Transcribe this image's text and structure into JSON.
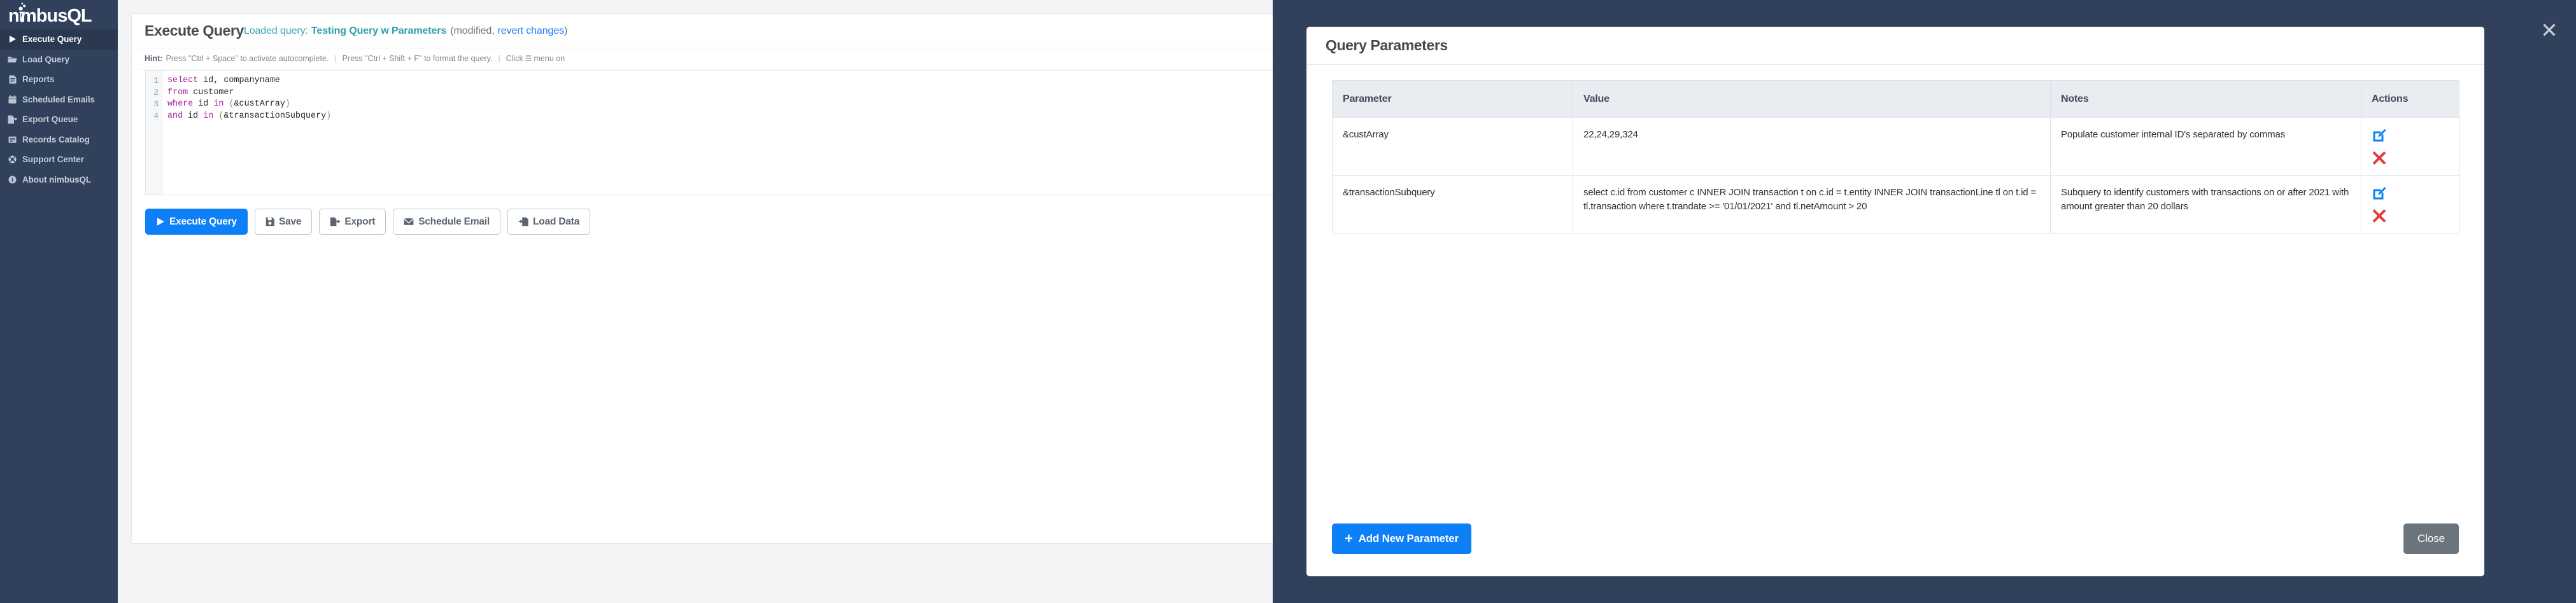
{
  "colors": {
    "sidebar_bg": "#31415c",
    "sidebar_active_bg": "#2a3850",
    "accent_blue": "#0d7ff7",
    "teal": "#2aa0ab",
    "link_blue": "#1a7df0",
    "danger_red": "#e03b3b",
    "close_gray": "#6c757d"
  },
  "sidebar": {
    "brand": "nimbusQL",
    "brand_icon": "flask-icon",
    "items": [
      {
        "label": "Execute Query",
        "icon": "play-icon",
        "active": true
      },
      {
        "label": "Load Query",
        "icon": "folder-open-icon",
        "active": false
      },
      {
        "label": "Reports",
        "icon": "document-icon",
        "active": false
      },
      {
        "label": "Scheduled Emails",
        "icon": "calendar-icon",
        "active": false
      },
      {
        "label": "Export Queue",
        "icon": "file-export-icon",
        "active": false
      },
      {
        "label": "Records Catalog",
        "icon": "database-icon",
        "active": false
      },
      {
        "label": "Support Center",
        "icon": "lifebuoy-icon",
        "active": false
      },
      {
        "label": "About nimbusQL",
        "icon": "info-icon",
        "active": false
      }
    ]
  },
  "main": {
    "page_title": "Execute Query",
    "loaded_prefix": "Loaded query:",
    "loaded_query_name": "Testing Query w Parameters",
    "open_paren": "(",
    "modified_text": "modified,",
    "revert_link": "revert changes",
    "close_paren": ")",
    "hint": {
      "label": "Hint:",
      "part1": "Press \"Ctrl + Space\" to activate autocomplete.",
      "sep": "|",
      "part2": "Press \"Ctrl + Shift + F\" to format the query.",
      "part3_pre": "Click",
      "burger": "☰",
      "part3_post": "menu on"
    },
    "editor": {
      "line_numbers": [
        "1",
        "2",
        "3",
        "4"
      ],
      "lines": [
        {
          "tokens": [
            {
              "t": "select",
              "c": "kw"
            },
            {
              "t": " id, companyname",
              "c": ""
            }
          ]
        },
        {
          "tokens": [
            {
              "t": "from",
              "c": "kw"
            },
            {
              "t": " customer",
              "c": ""
            }
          ]
        },
        {
          "tokens": [
            {
              "t": "where",
              "c": "kw"
            },
            {
              "t": " id ",
              "c": ""
            },
            {
              "t": "in",
              "c": "kw"
            },
            {
              "t": " ",
              "c": ""
            },
            {
              "t": "(",
              "c": "par"
            },
            {
              "t": "&custArray",
              "c": ""
            },
            {
              "t": ")",
              "c": "par"
            }
          ]
        },
        {
          "tokens": [
            {
              "t": "and",
              "c": "kw"
            },
            {
              "t": " id ",
              "c": ""
            },
            {
              "t": "in",
              "c": "kw"
            },
            {
              "t": " ",
              "c": ""
            },
            {
              "t": "(",
              "c": "par"
            },
            {
              "t": "&transactionSubquery",
              "c": ""
            },
            {
              "t": ")",
              "c": "par"
            }
          ]
        }
      ]
    },
    "toolbar": [
      {
        "label": "Execute Query",
        "icon": "play-icon",
        "primary": true
      },
      {
        "label": "Save",
        "icon": "save-icon",
        "primary": false
      },
      {
        "label": "Export",
        "icon": "file-export-icon",
        "primary": false
      },
      {
        "label": "Schedule Email",
        "icon": "envelope-icon",
        "primary": false
      },
      {
        "label": "Load Data",
        "icon": "load-data-icon",
        "primary": false
      }
    ]
  },
  "modal": {
    "title": "Query Parameters",
    "overlay_close_icon": "close-icon",
    "overlay_close_glyph": "✕",
    "table": {
      "headers": [
        "Parameter",
        "Value",
        "Notes",
        "Actions"
      ],
      "rows": [
        {
          "parameter": "&custArray",
          "value": "22,24,29,324",
          "notes": "Populate customer internal ID's separated by commas",
          "actions": [
            "edit-icon",
            "delete-icon"
          ]
        },
        {
          "parameter": "&transactionSubquery",
          "value": "select c.id from customer c INNER JOIN transaction t on c.id = t.entity INNER JOIN transactionLine tl on t.id = tl.transaction where t.trandate >= '01/01/2021' and tl.netAmount > 20",
          "notes": "Subquery to identify customers with transactions on or after 2021 with amount greater than 20 dollars",
          "actions": [
            "edit-icon",
            "delete-icon"
          ]
        }
      ]
    },
    "add_button": "Add New Parameter",
    "add_button_glyph": "+",
    "close_button": "Close"
  }
}
